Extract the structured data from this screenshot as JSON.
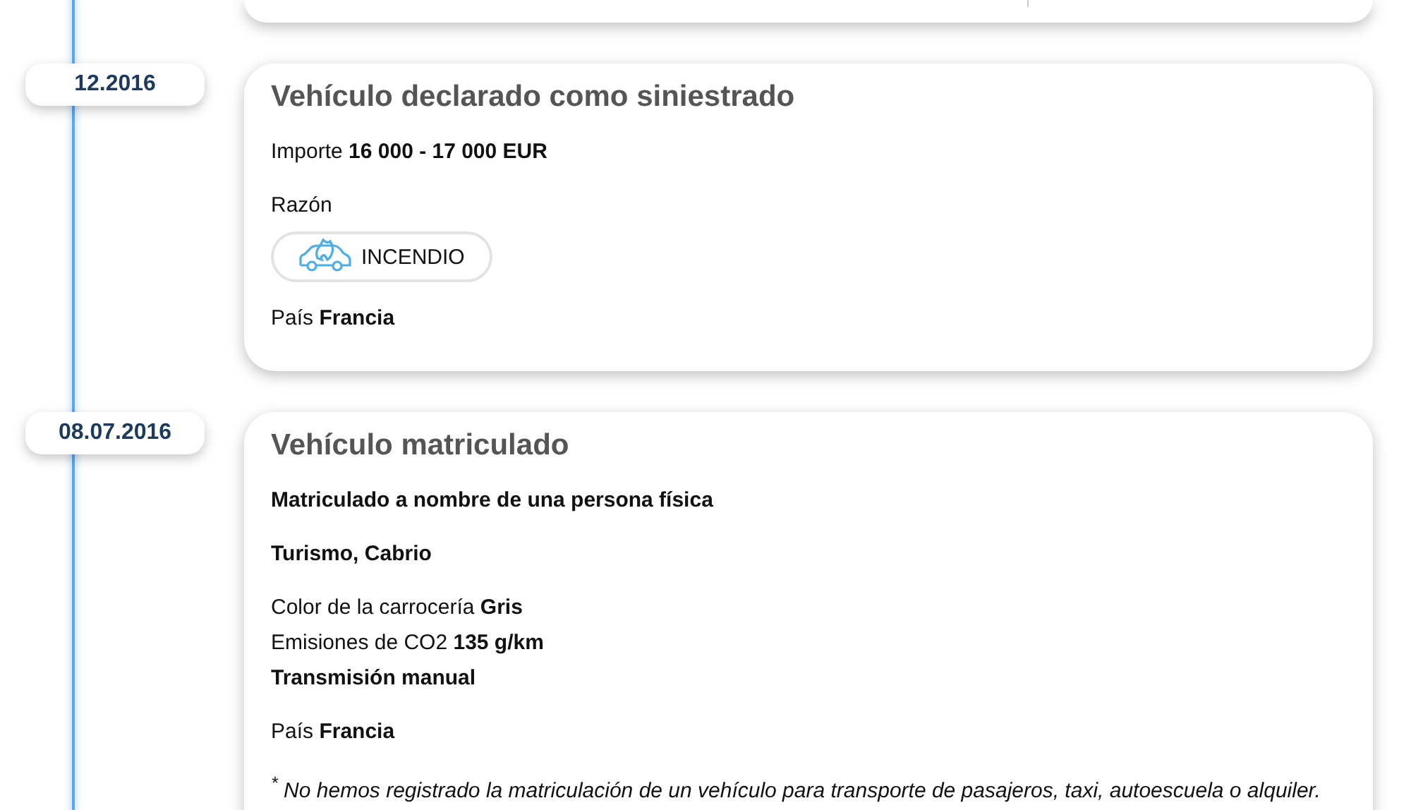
{
  "events": [
    {
      "date": "12.2016",
      "title": "Vehículo declarado como siniestrado",
      "groups": [
        [
          {
            "kind": "pair",
            "label": "Importe",
            "value": "16 000 - 17 000 EUR"
          }
        ],
        [
          {
            "kind": "text",
            "text": "Razón"
          },
          {
            "kind": "tag",
            "text": "INCENDIO"
          }
        ],
        [
          {
            "kind": "pair",
            "label": "País",
            "value": "Francia"
          }
        ]
      ]
    },
    {
      "date": "08.07.2016",
      "title": "Vehículo matriculado",
      "groups": [
        [
          {
            "kind": "bold",
            "text": "Matriculado a nombre de una persona física"
          }
        ],
        [
          {
            "kind": "bold",
            "text": "Turismo, Cabrio"
          }
        ],
        [
          {
            "kind": "pair",
            "label": "Color de la carrocería",
            "value": "Gris"
          },
          {
            "kind": "pair",
            "label": "Emisiones de CO2",
            "value": "135 g/km"
          },
          {
            "kind": "bold",
            "text": "Transmisión manual"
          }
        ],
        [
          {
            "kind": "pair",
            "label": "País",
            "value": "Francia"
          }
        ],
        [
          {
            "kind": "note",
            "text": "$^{*}$ No hemos registrado la matriculación de un vehículo para transporte de pasajeros, taxi, autoescuela o alquiler."
          }
        ]
      ]
    }
  ]
}
